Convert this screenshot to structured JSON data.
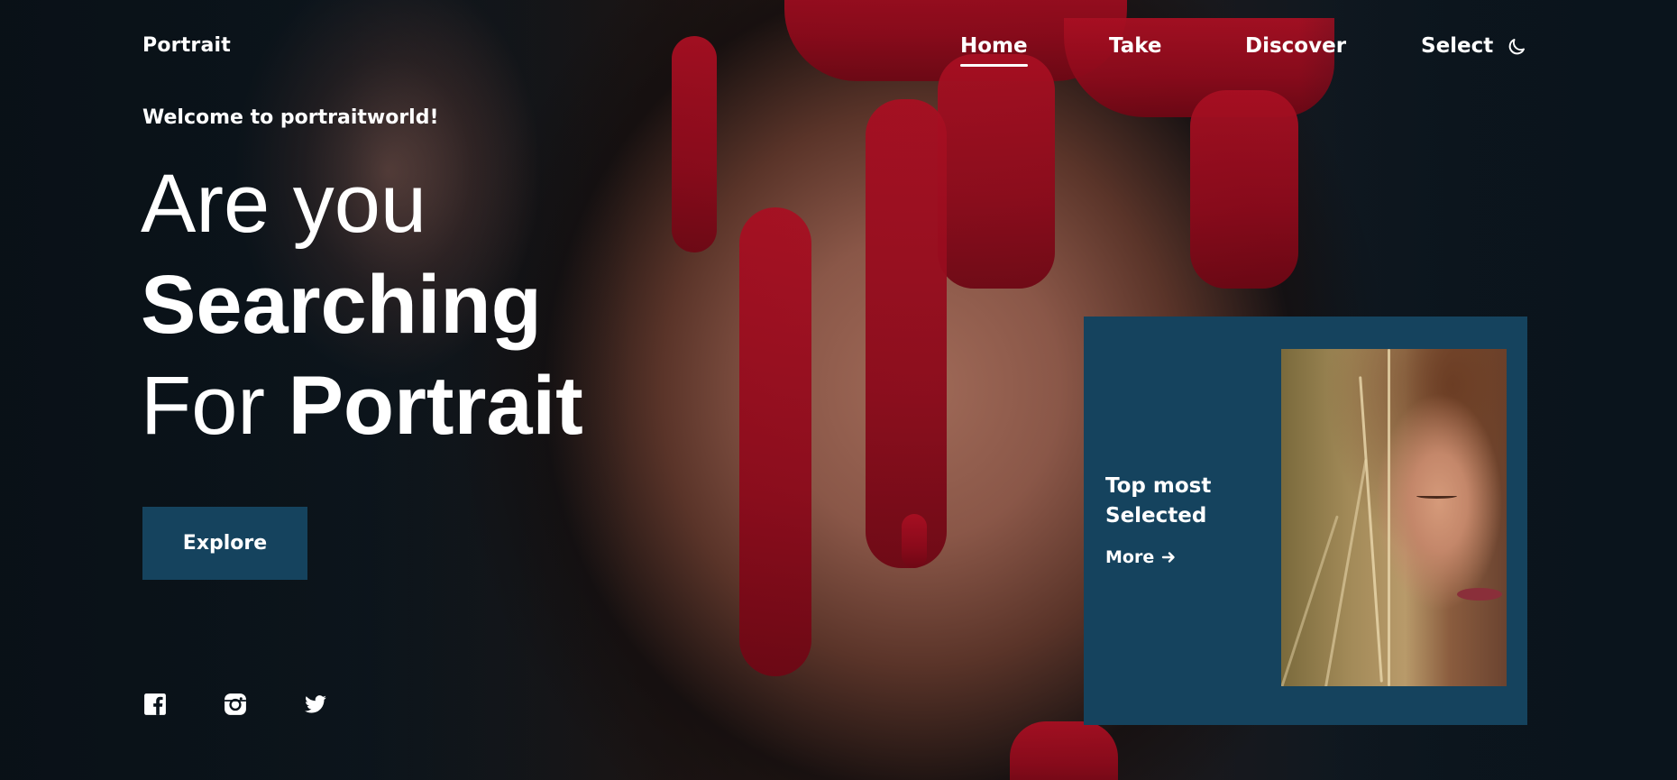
{
  "header": {
    "logo": "Portrait",
    "nav": {
      "home": "Home",
      "take": "Take",
      "discover": "Discover",
      "select": "Select"
    },
    "theme_toggle_icon": "moon-icon"
  },
  "hero": {
    "welcome": "Welcome to portraitworld!",
    "headline": {
      "line1": "Are you",
      "line2": "Searching",
      "line3_light": "For",
      "line3_bold": "Portrait"
    },
    "explore_label": "Explore"
  },
  "social": [
    {
      "icon": "facebook-icon"
    },
    {
      "icon": "instagram-icon"
    },
    {
      "icon": "twitter-icon"
    }
  ],
  "card": {
    "title_line1": "Top most",
    "title_line2": "Selected",
    "more_label": "More",
    "more_icon": "arrow-right-icon"
  },
  "colors": {
    "accent": "#15435e",
    "background": "#0b141c",
    "paint_red": "#a80f22"
  }
}
